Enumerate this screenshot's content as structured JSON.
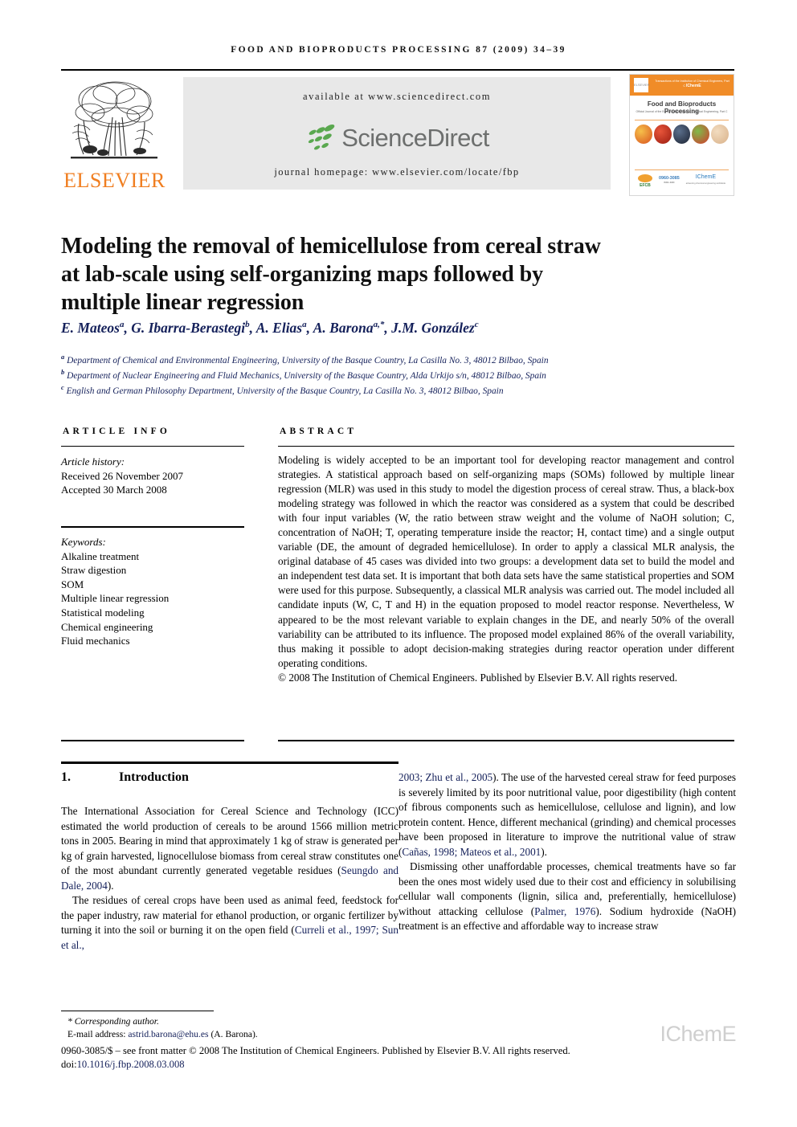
{
  "running_head": "FOOD AND BIOPRODUCTS PROCESSING 87 (2009) 34–39",
  "banner": {
    "publisher": "ELSEVIER",
    "available_at": "available at www.sciencedirect.com",
    "sciencedirect_wordmark": "ScienceDirect",
    "journal_homepage": "journal homepage: www.elsevier.com/locate/fbp"
  },
  "cover": {
    "header_small": "Transactions of the Institution of Chemical Engineers, Part C",
    "header_brand": "IChemE",
    "elsevier_mark": "ELSEVIER",
    "title": "Food and Bioproducts Processing",
    "subtitle": "Official Journal of the European Federation of Chemical Engineering, Part C",
    "logo_efcb": "EFCB",
    "logo_issn": "ISSN–0960",
    "logo_issn_sub": "0960-3085",
    "logo_ichem": "IChemE",
    "logo_ichem_sub": "advancing chemical engineering worldwide"
  },
  "article": {
    "title": "Modeling the removal of hemicellulose from cereal straw at lab-scale using self-organizing maps followed by multiple linear regression",
    "authors_html": "E. Mateos<sup>a</sup>, G. Ibarra-Berastegi<sup>b</sup>, A. Elias<sup>a</sup>, A. Barona<sup>a,*</sup>, J.M. González<sup>c</sup>",
    "affiliations": [
      "Department of Chemical and Environmental Engineering, University of the Basque Country, La Casilla No. 3, 48012 Bilbao, Spain",
      "Department of Nuclear Engineering and Fluid Mechanics, University of the Basque Country, Alda Urkijo s/n, 48012 Bilbao, Spain",
      "English and German Philosophy Department, University of the Basque Country, La Casilla No. 3, 48012 Bilbao, Spain"
    ],
    "affiliation_marks": [
      "a",
      "b",
      "c"
    ]
  },
  "article_info": {
    "label": "ARTICLE INFO",
    "history_label": "Article history:",
    "received": "Received 26 November 2007",
    "accepted": "Accepted 30 March 2008",
    "keywords_label": "Keywords:",
    "keywords": [
      "Alkaline treatment",
      "Straw digestion",
      "SOM",
      "Multiple linear regression",
      "Statistical modeling",
      "Chemical engineering",
      "Fluid mechanics"
    ]
  },
  "abstract": {
    "label": "ABSTRACT",
    "text": "Modeling is widely accepted to be an important tool for developing reactor management and control strategies. A statistical approach based on self-organizing maps (SOMs) followed by multiple linear regression (MLR) was used in this study to model the digestion process of cereal straw. Thus, a black-box modeling strategy was followed in which the reactor was considered as a system that could be described with four input variables (W, the ratio between straw weight and the volume of NaOH solution; C, concentration of NaOH; T, operating temperature inside the reactor; H, contact time) and a single output variable (DE, the amount of degraded hemicellulose). In order to apply a classical MLR analysis, the original database of 45 cases was divided into two groups: a development data set to build the model and an independent test data set. It is important that both data sets have the same statistical properties and SOM were used for this purpose. Subsequently, a classical MLR analysis was carried out. The model included all candidate inputs (W, C, T and H) in the equation proposed to model reactor response. Nevertheless, W appeared to be the most relevant variable to explain changes in the DE, and nearly 50% of the overall variability can be attributed to its influence. The proposed model explained 86% of the overall variability, thus making it possible to adopt decision-making strategies during reactor operation under different operating conditions.",
    "copyright": "© 2008 The Institution of Chemical Engineers. Published by Elsevier B.V. All rights reserved."
  },
  "section": {
    "number": "1.",
    "title": "Introduction"
  },
  "body": {
    "left_paragraphs": [
      "The International Association for Cereal Science and Technology (ICC) estimated the world production of cereals to be around 1566 million metric tons in 2005. Bearing in mind that approximately 1 kg of straw is generated per kg of grain harvested, lignocellulose biomass from cereal straw constitutes one of the most abundant currently generated vegetable residues (<cite>Seungdo and Dale, 2004</cite>).",
      "The residues of cereal crops have been used as animal feed, feedstock for the paper industry, raw material for ethanol production, or organic fertilizer by turning it into the soil or burning it on the open field (<cite>Curreli et al., 1997; Sun et al.,</cite>"
    ],
    "right_paragraphs": [
      "<cite>2003; Zhu et al., 2005</cite>). The use of the harvested cereal straw for feed purposes is severely limited by its poor nutritional value, poor digestibility (high content of fibrous components such as hemicellulose, cellulose and lignin), and low protein content. Hence, different mechanical (grinding) and chemical processes have been proposed in literature to improve the nutritional value of straw (<cite>Cañas, 1998; Mateos et al., 2001</cite>).",
      "Dismissing other unaffordable processes, chemical treatments have so far been the ones most widely used due to their cost and efficiency in solubilising cellular wall components (lignin, silica and, preferentially, hemicellulose) without attacking cellulose (<cite>Palmer, 1976</cite>). Sodium hydroxide (NaOH) treatment is an effective and affordable way to increase straw"
    ]
  },
  "footer": {
    "corresponding_author": "* Corresponding author.",
    "email_label": "E-mail address:",
    "email": "astrid.barona@ehu.es",
    "email_suffix": "(A. Barona).",
    "front_matter": "0960-3085/$ – see front matter © 2008 The Institution of Chemical Engineers. Published by Elsevier B.V. All rights reserved.",
    "doi_label": "doi:",
    "doi_value": "10.1016/j.fbp.2008.03.008",
    "watermark": "IChemE"
  },
  "colors": {
    "elsevier_orange": "#F07E20",
    "link_blue": "#14205a",
    "sciencedirect_gray": "#6d6f6e",
    "box_gray": "#e8e8e8"
  }
}
